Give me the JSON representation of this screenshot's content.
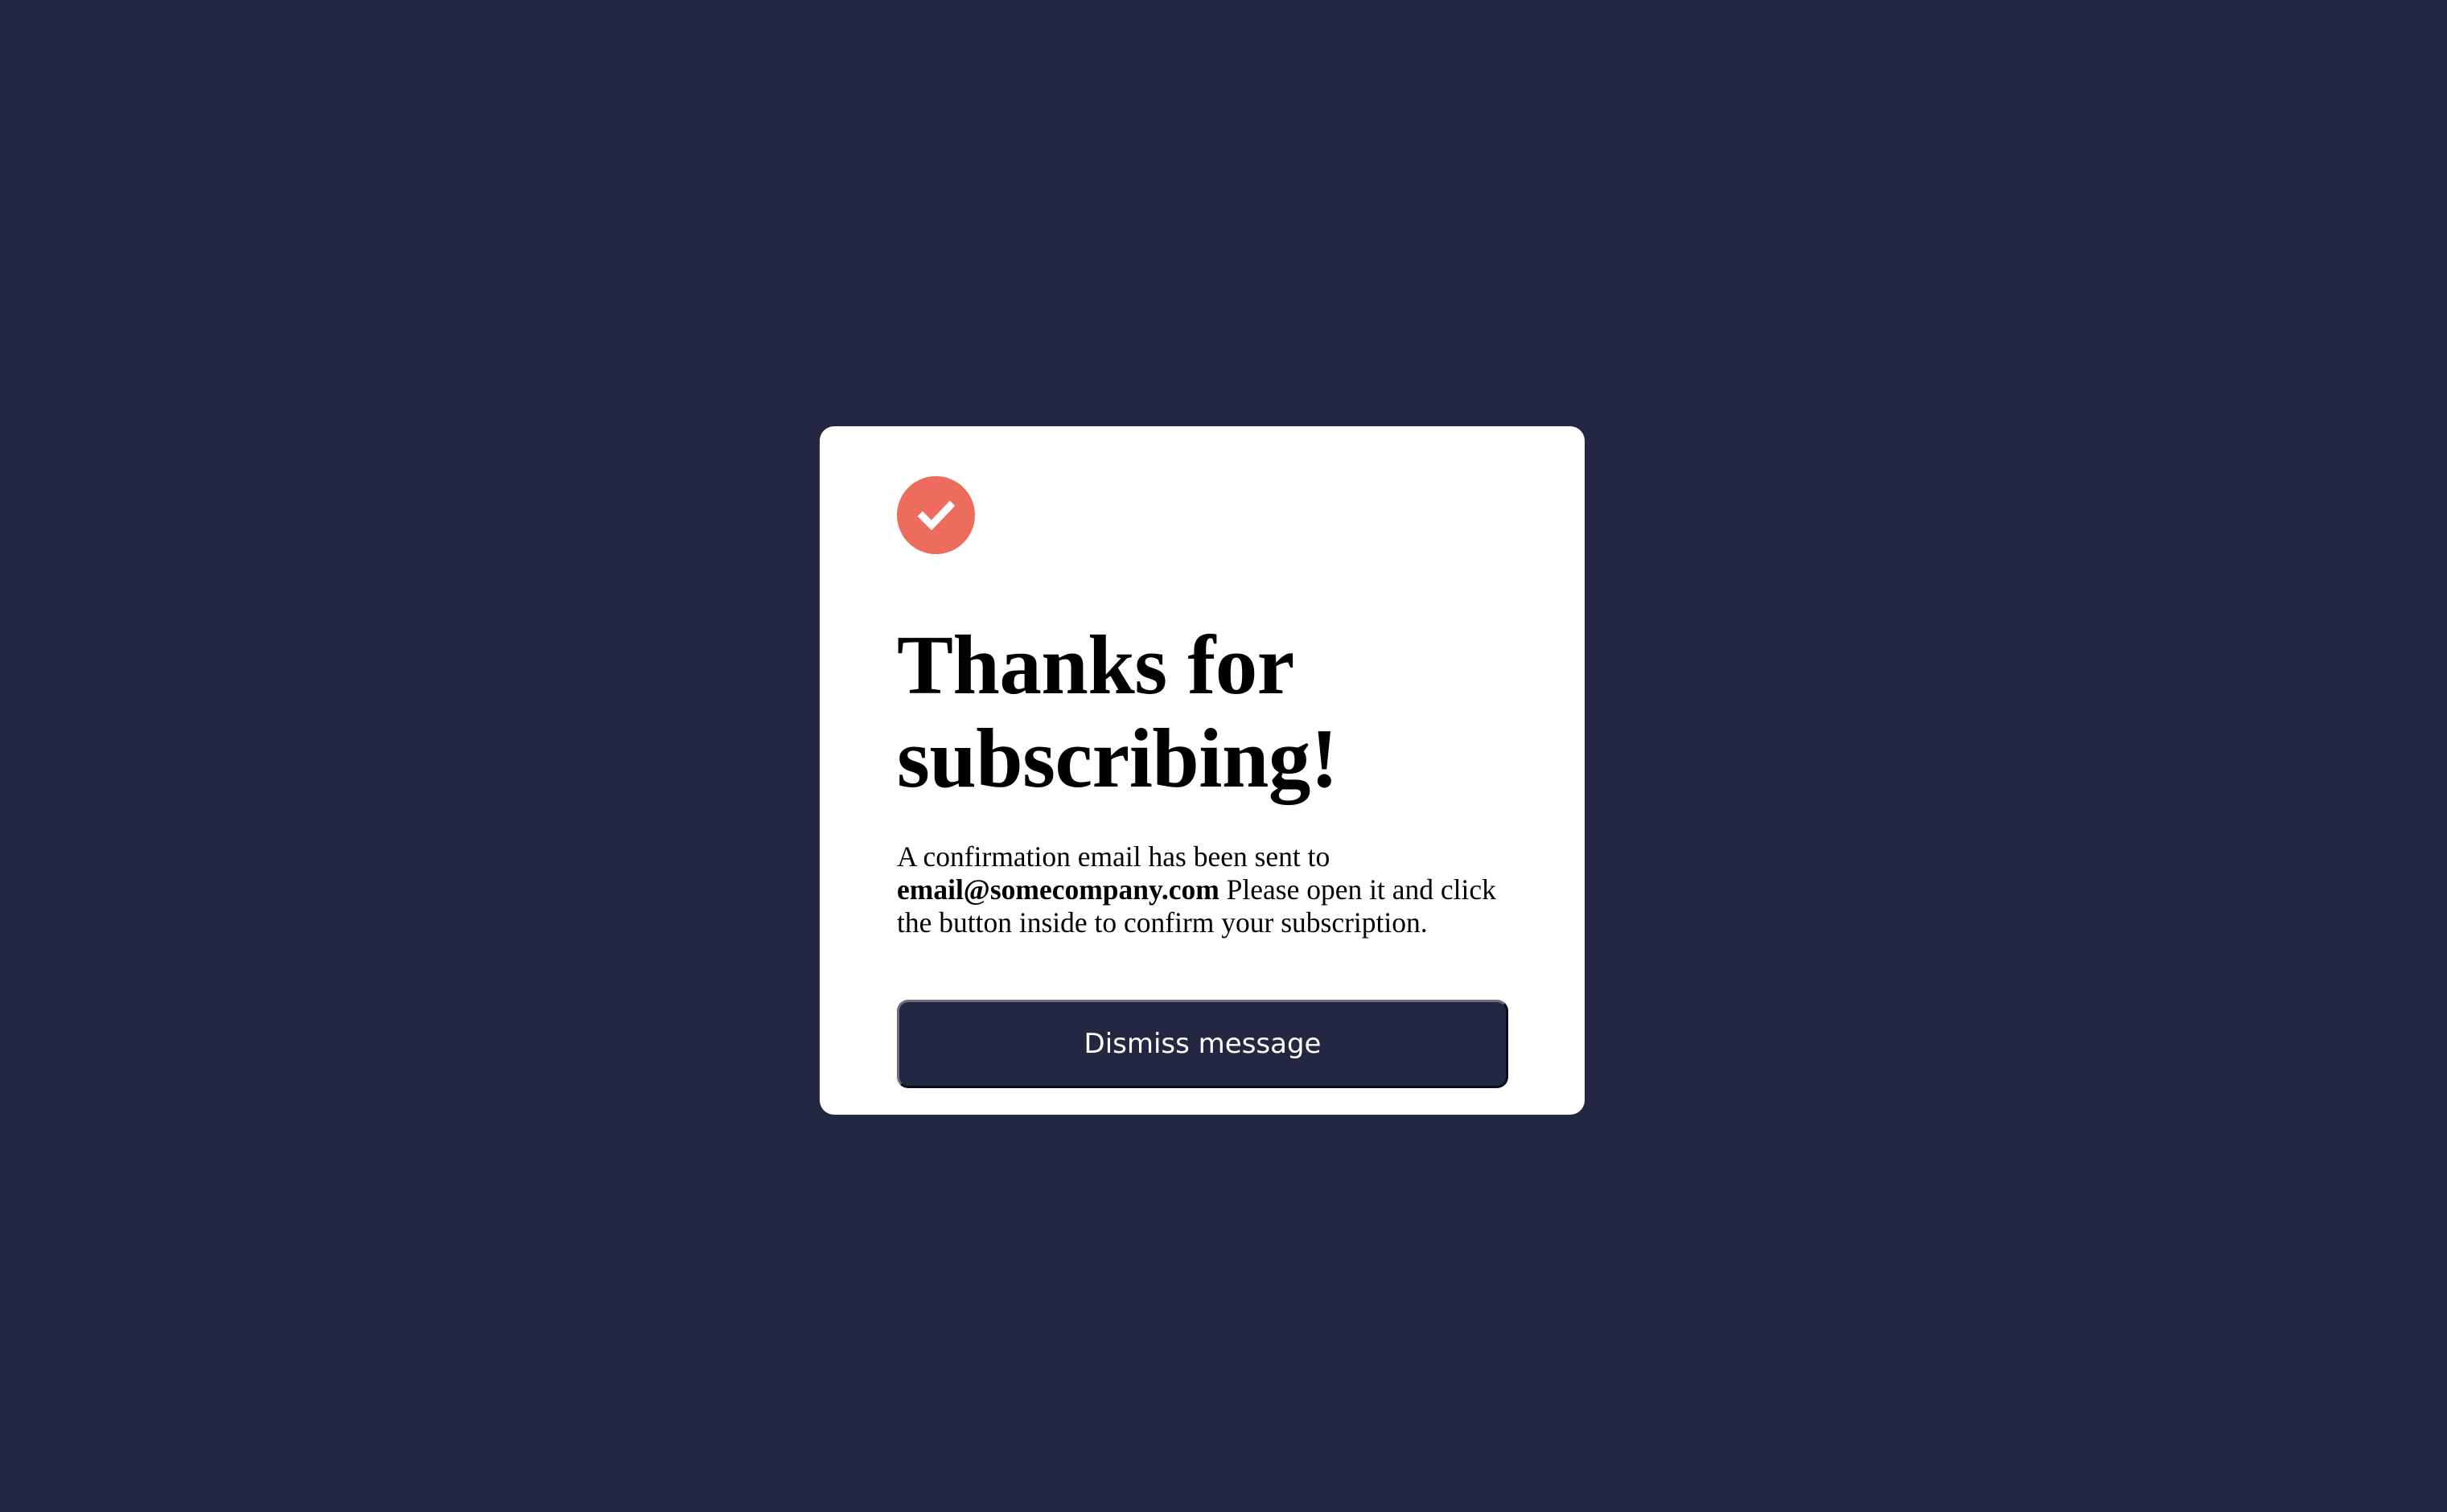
{
  "modal": {
    "icon": "check-circle-icon",
    "accent_color": "#EE6C5E",
    "title": "Thanks for subscribing!",
    "message_prefix": "A confirmation email has been sent to",
    "email": "email@somecompany.com",
    "message_suffix": "Please open it and click the button inside to confirm your subscription.",
    "dismiss_label": "Dismiss message"
  },
  "theme": {
    "background": "#242742",
    "card": "#FFFFFF",
    "button": "#242742"
  }
}
